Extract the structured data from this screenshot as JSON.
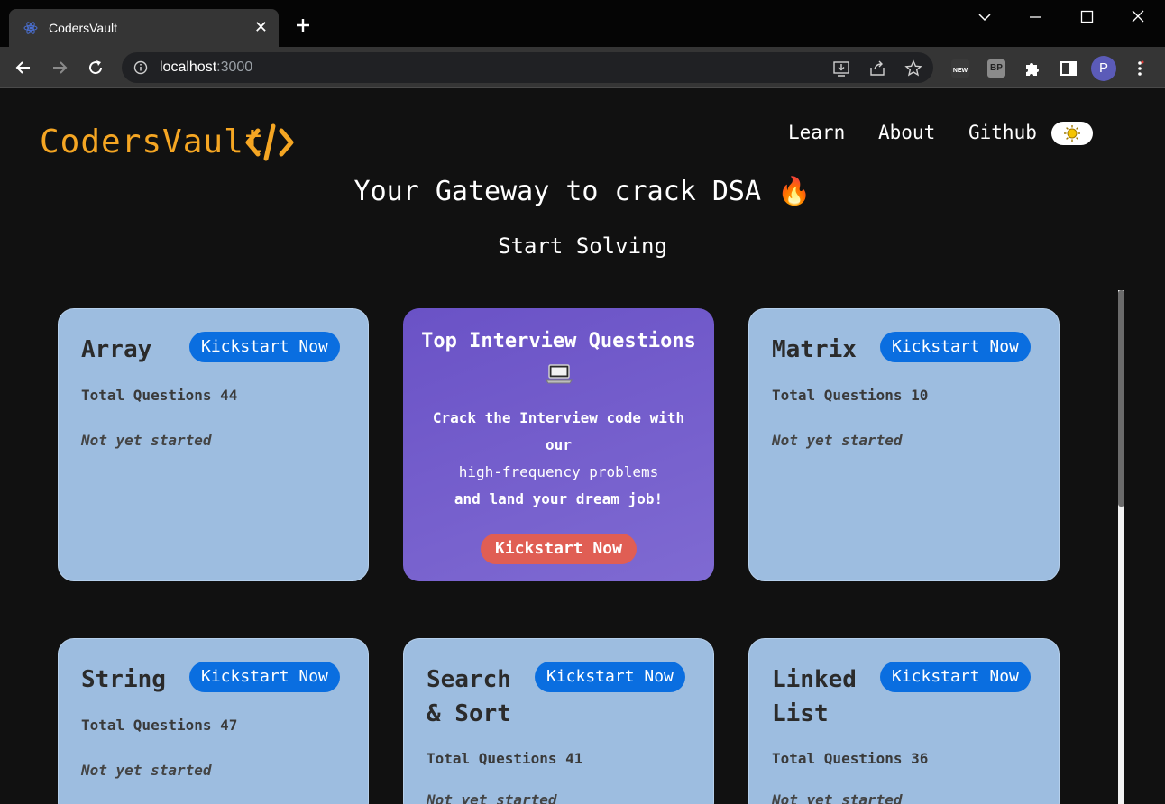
{
  "browser": {
    "tab_title": "CodersVault",
    "url_host": "localhost",
    "url_port": ":3000",
    "extension_new_label": "NEW",
    "extension_bp_label": "BP",
    "profile_initial": "P"
  },
  "site": {
    "logo_text": "CodersVault",
    "nav": [
      "Learn",
      "About",
      "Github"
    ],
    "hero": "Your Gateway to crack DSA 🔥",
    "subheading": "Start Solving"
  },
  "cards": [
    {
      "title": "Array",
      "button": "Kickstart Now",
      "total": "Total Questions 44",
      "status": "Not yet started"
    },
    {
      "title": "Matrix",
      "button": "Kickstart Now",
      "total": "Total Questions 10",
      "status": "Not yet started"
    },
    {
      "title": "String",
      "button": "Kickstart Now",
      "total": "Total Questions 47",
      "status": "Not yet started"
    },
    {
      "title_line1": "Search",
      "title_line2": "& Sort",
      "button": "Kickstart Now",
      "total": "Total Questions 41",
      "status": "Not yet started"
    },
    {
      "title_line1": "Linked",
      "title_line2": "List",
      "button": "Kickstart Now",
      "total": "Total Questions 36",
      "status": "Not yet started"
    }
  ],
  "feature": {
    "title": "Top Interview Questions",
    "lines": [
      "Crack the Interview code with",
      "our",
      "high-frequency problems",
      "and land your dream job!"
    ],
    "button": "Kickstart Now"
  },
  "colors": {
    "logo": "#f5a623",
    "card_bg": "#9dbde0",
    "kickstart_button": "#0a6ee0",
    "feature_bg": "#6a52c6",
    "feature_button": "#e05e54"
  }
}
